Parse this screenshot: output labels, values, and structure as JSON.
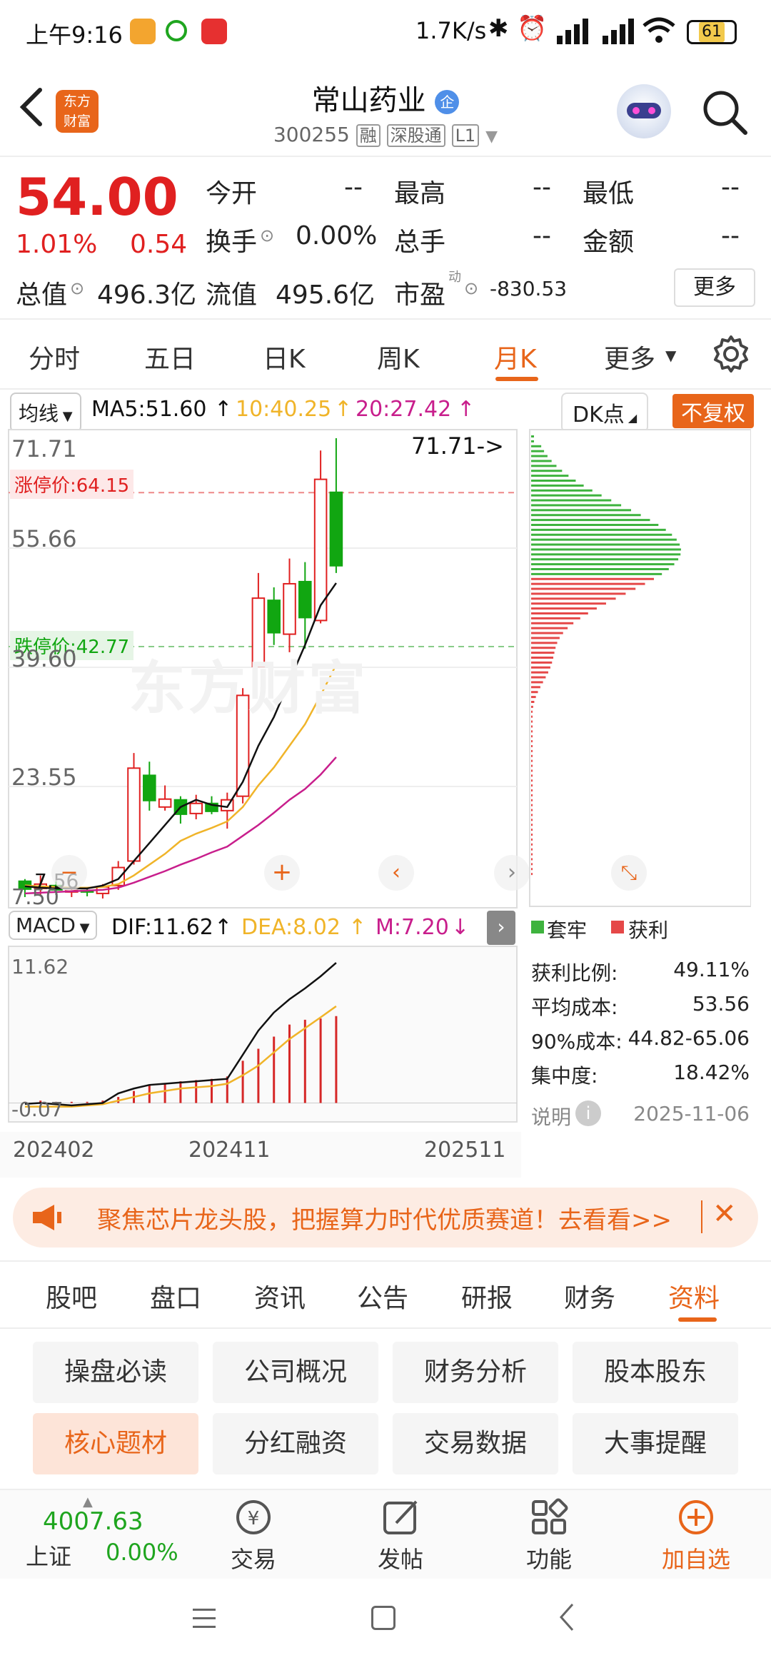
{
  "status": {
    "time": "上午9:16",
    "speed": "1.7K/s",
    "battery": "61"
  },
  "header": {
    "title": "常山药业",
    "code": "300255",
    "tag1": "融",
    "tag2": "深股通",
    "tag3": "L1",
    "logo_line1": "东方",
    "logo_line2": "财富"
  },
  "quote": {
    "price": "54.00",
    "pct": "1.01%",
    "change": "0.54",
    "rows": [
      [
        {
          "k": "今开",
          "v": "--"
        },
        {
          "k": "最高",
          "v": "--"
        },
        {
          "k": "最低",
          "v": "--"
        }
      ],
      [
        {
          "k": "换手",
          "v": "0.00%"
        },
        {
          "k": "总手",
          "v": "--"
        },
        {
          "k": "金额",
          "v": "--"
        }
      ]
    ],
    "mktcap_label": "总值",
    "mktcap": "496.3亿",
    "float_label": "流值",
    "float": "495.6亿",
    "pe_label": "市盈",
    "pe_sup": "动",
    "pe": "-830.53",
    "more": "更多"
  },
  "tabs": [
    "分时",
    "五日",
    "日K",
    "周K",
    "月K",
    "更多"
  ],
  "active_tab": "月K",
  "ma": {
    "selector": "均线",
    "ma5": "MA5:51.60",
    "ma10": "10:40.25",
    "ma20": "20:27.42",
    "dk": "DK点",
    "adjust": "不复权"
  },
  "chart": {
    "high_label": "71.71",
    "high_marker": "71.71->",
    "limit_up": "涨停价:64.15",
    "limit_down": "跌停价:42.77",
    "y_labels": [
      "55.66",
      "39.60",
      "23.55"
    ],
    "low_marker": "7.56",
    "low_label": "7.50",
    "watermark": "东方财富",
    "colors": {
      "up": "#e02020",
      "down": "#11a611",
      "ma5": "#111111",
      "ma10": "#f0b429",
      "ma20": "#c81e8c"
    }
  },
  "macd": {
    "selector": "MACD",
    "dif": "DIF:11.62",
    "dea": "DEA:8.02",
    "m": "M:7.20",
    "top": "11.62",
    "bottom": "-0.07",
    "dates": [
      "202402",
      "202411",
      "202511"
    ]
  },
  "chart_data": {
    "type": "candlestick",
    "ylim": [
      7.5,
      71.71
    ],
    "x_labels": [
      "202402",
      "202411",
      "202511"
    ],
    "candles": [
      {
        "o": 10.2,
        "c": 9.1,
        "h": 10.5,
        "l": 8.0,
        "up": false
      },
      {
        "o": 9.2,
        "c": 9.8,
        "h": 11.0,
        "l": 8.2,
        "up": true
      },
      {
        "o": 9.6,
        "c": 9.0,
        "h": 10.2,
        "l": 8.3,
        "up": false
      },
      {
        "o": 8.9,
        "c": 8.9,
        "h": 9.3,
        "l": 8.0,
        "up": true
      },
      {
        "o": 8.9,
        "c": 8.8,
        "h": 9.2,
        "l": 8.1,
        "up": false
      },
      {
        "o": 8.5,
        "c": 9.4,
        "h": 9.8,
        "l": 7.8,
        "up": true
      },
      {
        "o": 9.6,
        "c": 12.1,
        "h": 13.0,
        "l": 9.0,
        "up": true
      },
      {
        "o": 13.0,
        "c": 25.9,
        "h": 28.0,
        "l": 12.5,
        "up": true
      },
      {
        "o": 24.9,
        "c": 21.4,
        "h": 26.8,
        "l": 20.0,
        "up": false
      },
      {
        "o": 20.5,
        "c": 21.6,
        "h": 23.5,
        "l": 20.0,
        "up": true
      },
      {
        "o": 21.5,
        "c": 19.5,
        "h": 22.0,
        "l": 18.2,
        "up": false
      },
      {
        "o": 19.6,
        "c": 21.0,
        "h": 22.2,
        "l": 18.8,
        "up": true
      },
      {
        "o": 21.0,
        "c": 19.9,
        "h": 22.0,
        "l": 19.5,
        "up": false
      },
      {
        "o": 20.0,
        "c": 21.5,
        "h": 22.5,
        "l": 17.5,
        "up": true
      },
      {
        "o": 22.0,
        "c": 36.0,
        "h": 37.0,
        "l": 21.0,
        "up": true
      },
      {
        "o": 40.0,
        "c": 49.5,
        "h": 53.0,
        "l": 40.0,
        "up": true
      },
      {
        "o": 49.2,
        "c": 44.7,
        "h": 51.0,
        "l": 43.0,
        "up": false
      },
      {
        "o": 44.5,
        "c": 51.5,
        "h": 55.0,
        "l": 42.0,
        "up": true
      },
      {
        "o": 51.8,
        "c": 46.8,
        "h": 54.5,
        "l": 42.5,
        "up": false
      },
      {
        "o": 46.4,
        "c": 66.0,
        "h": 70.0,
        "l": 46.0,
        "up": true
      },
      {
        "o": 64.2,
        "c": 54.0,
        "h": 71.71,
        "l": 53.0,
        "up": false
      }
    ],
    "ma5": [
      9.5,
      9.3,
      9.2,
      9.2,
      9.2,
      9.6,
      10.5,
      13.0,
      15.5,
      18.0,
      20.5,
      21.5,
      20.8,
      20.5,
      24.0,
      29.0,
      33.0,
      38.0,
      43.0,
      48.5,
      51.6
    ],
    "ma10": [
      9.6,
      9.5,
      9.4,
      9.3,
      9.3,
      9.4,
      9.8,
      11.0,
      12.5,
      14.0,
      15.8,
      16.8,
      17.6,
      18.5,
      20.5,
      23.5,
      26.0,
      29.0,
      32.0,
      36.0,
      40.25
    ],
    "ma20": [
      8.5,
      8.6,
      8.7,
      8.8,
      8.9,
      9.0,
      9.3,
      10.0,
      10.8,
      11.6,
      12.5,
      13.3,
      14.2,
      15.0,
      16.5,
      18.0,
      19.7,
      21.5,
      23.0,
      25.0,
      27.42
    ],
    "macd_dif": [
      -0.07,
      0.0,
      -0.1,
      -0.2,
      -0.1,
      0.0,
      0.8,
      1.2,
      1.5,
      1.6,
      1.7,
      1.8,
      1.9,
      2.0,
      4.0,
      6.0,
      7.5,
      8.6,
      9.5,
      10.5,
      11.62
    ],
    "macd_dea": [
      -0.3,
      -0.3,
      -0.3,
      -0.3,
      -0.2,
      -0.1,
      0.2,
      0.5,
      0.8,
      1.0,
      1.2,
      1.3,
      1.4,
      1.6,
      2.3,
      3.1,
      4.2,
      5.3,
      6.2,
      7.1,
      8.02
    ],
    "macd_m": [
      0.1,
      0.2,
      0.1,
      0.1,
      0.1,
      0.2,
      0.5,
      1.0,
      1.5,
      1.6,
      1.8,
      1.9,
      2.0,
      2.2,
      3.5,
      4.5,
      5.5,
      6.5,
      6.9,
      7.0,
      7.2
    ]
  },
  "dk": {
    "legend_trapped": "套牢",
    "legend_profit": "获利",
    "stats": [
      {
        "k": "获利比例:",
        "v": "49.11%"
      },
      {
        "k": "平均成本:",
        "v": "53.56"
      },
      {
        "k": "90%成本:",
        "v": "44.82-65.06"
      },
      {
        "k": "集中度:",
        "v": "18.42%"
      }
    ],
    "note": "说明",
    "date": "2025-11-06"
  },
  "banner": {
    "text": "聚焦芯片龙头股，把握算力时代优质赛道！去看看>>"
  },
  "subtabs": [
    "股吧",
    "盘口",
    "资讯",
    "公告",
    "研报",
    "财务",
    "资料"
  ],
  "active_subtab": "资料",
  "chips": [
    "操盘必读",
    "公司概况",
    "财务分析",
    "股本股东",
    "核心题材",
    "分红融资",
    "交易数据",
    "大事提醒"
  ],
  "active_chip": "核心题材",
  "bottom": {
    "index_value": "4007.63",
    "index_name": "上证",
    "index_pct": "0.00%",
    "trade": "交易",
    "post": "发帖",
    "func": "功能",
    "add": "加自选"
  }
}
